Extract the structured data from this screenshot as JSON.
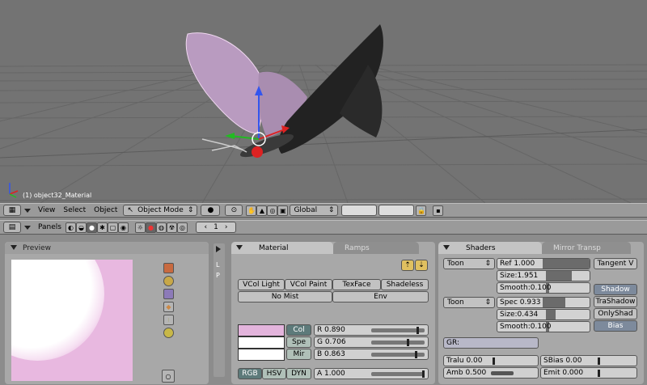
{
  "viewport": {
    "object_label": "(1) object32_Material"
  },
  "header3d": {
    "menus": [
      "View",
      "Select",
      "Object"
    ],
    "mode": "Object Mode",
    "orientation": "Global"
  },
  "buttons_header": {
    "panels_label": "Panels",
    "frame": "1"
  },
  "preview": {
    "title": "Preview"
  },
  "side_tabs": [
    "L",
    "P"
  ],
  "material": {
    "tabs": [
      "Material",
      "Ramps"
    ],
    "toggles_row1": [
      "VCol Light",
      "VCol Paint",
      "TexFace",
      "Shadeless"
    ],
    "toggles_row2": [
      "No Mist",
      "Env"
    ],
    "color_buttons": [
      "Col",
      "Spe",
      "Mir"
    ],
    "rgb": {
      "r": "R 0.890",
      "g": "G 0.706",
      "b": "B 0.863"
    },
    "rgb_values": {
      "r": 0.89,
      "g": 0.706,
      "b": 0.863
    },
    "modes": [
      "RGB",
      "HSV",
      "DYN"
    ],
    "alpha": "A 1.000",
    "alpha_value": 1.0,
    "col_color": "#e3b4dc"
  },
  "shaders": {
    "tabs": [
      "Shaders",
      "Mirror Transp"
    ],
    "diffuse_shader": "Toon",
    "specular_shader": "Toon",
    "ref": "Ref   1.000",
    "size1": "Size:1.951",
    "smooth1": "Smooth:0.100",
    "spec": "Spec 0.933",
    "size2": "Size:0.434",
    "smooth2": "Smooth:0.100",
    "tangent": "Tangent V",
    "shadow_buttons": [
      "Shadow",
      "TraShadow",
      "OnlyShad",
      "Bias"
    ],
    "gr": "GR:",
    "tralu": "Tralu 0.00",
    "sbias": "SBias 0.00",
    "amb": "Amb 0.500",
    "emit": "Emit 0.000"
  }
}
